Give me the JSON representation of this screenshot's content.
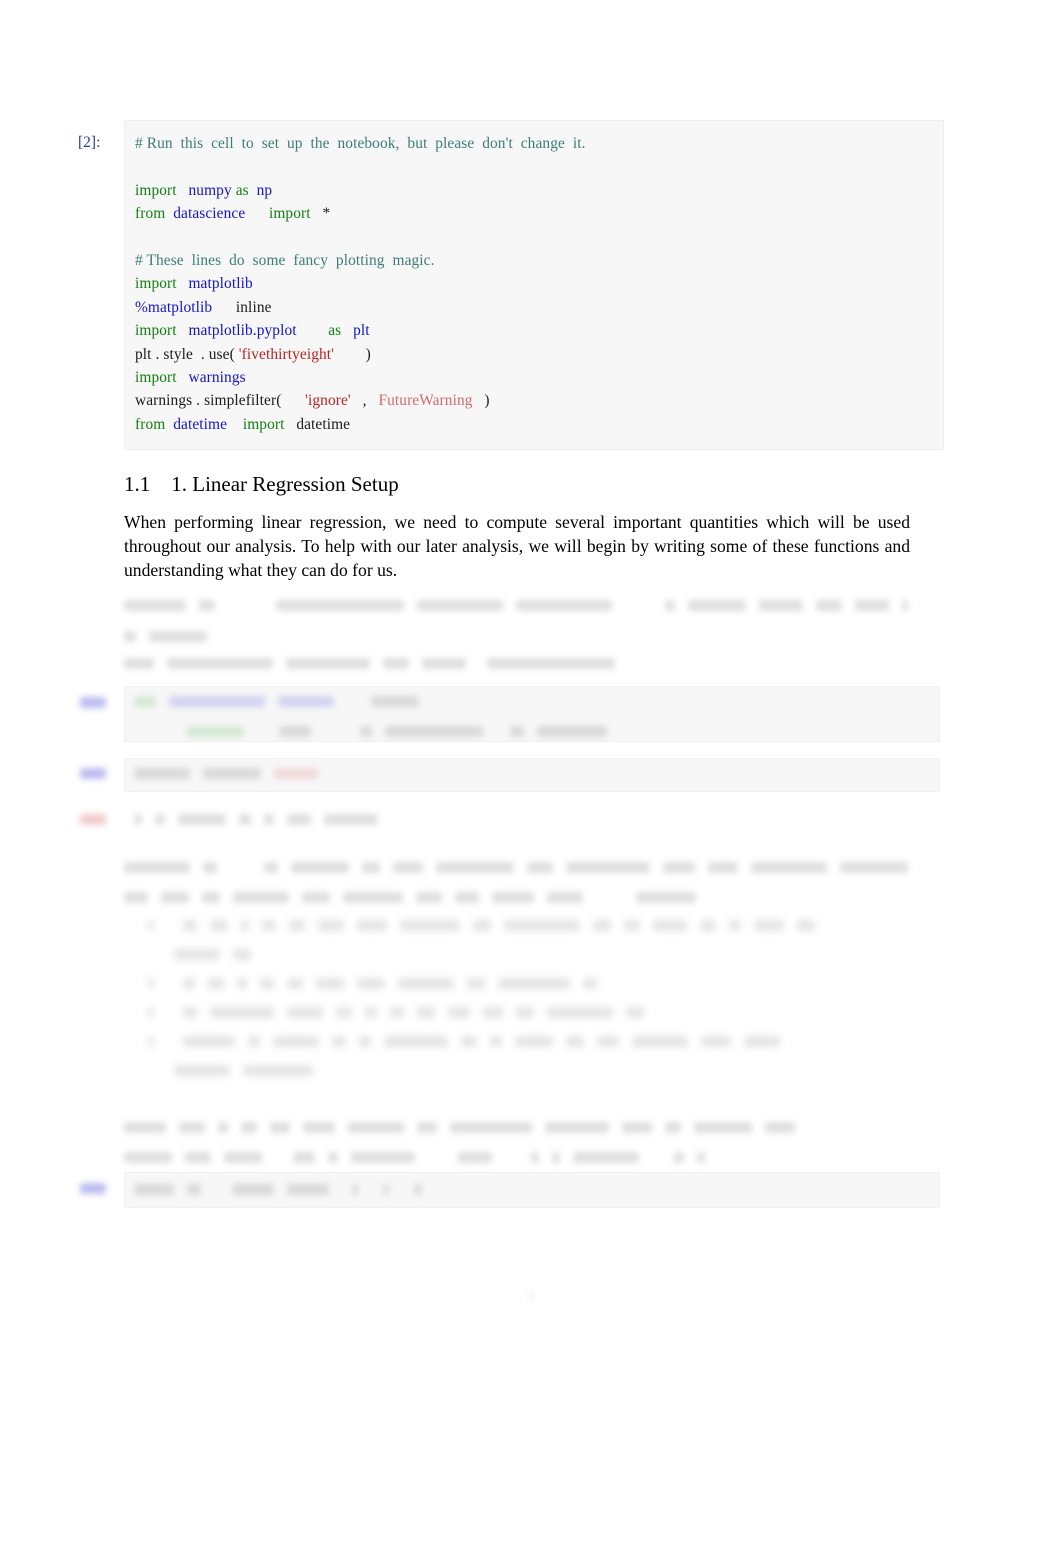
{
  "document": {
    "kind": "jupyter-notebook-export",
    "page_number": "1"
  },
  "code_cell": {
    "prompt": "[2]:",
    "lines": [
      {
        "type": "comment",
        "text": "# Run  this  cell  to  set  up  the  notebook,  but  please  don't  change  it."
      },
      {
        "type": "blank",
        "text": ""
      },
      {
        "type": "code",
        "text": "import   numpy as  np"
      },
      {
        "type": "code",
        "text": "from  datascience      import   *"
      },
      {
        "type": "blank",
        "text": ""
      },
      {
        "type": "comment",
        "text": "# These  lines  do  some  fancy  plotting  magic."
      },
      {
        "type": "code",
        "text": "import   matplotlib"
      },
      {
        "type": "code",
        "text": "%matplotlib      inline"
      },
      {
        "type": "code",
        "text": "import   matplotlib.pyplot        as   plt"
      },
      {
        "type": "code",
        "text": "plt . style  . use( 'fivethirtyeight'        )"
      },
      {
        "type": "code",
        "text": "import   warnings"
      },
      {
        "type": "code",
        "text": "warnings . simplefilter(      'ignore'   ,   FutureWarning   )"
      },
      {
        "type": "code",
        "text": "from  datetime    import   datetime"
      }
    ],
    "tokens": {
      "comment_1": "# Run  this  cell  to  set  up  the  notebook,  but  please  don't  change  it.",
      "comment_2": "# These  lines  do  some  fancy  plotting  magic.",
      "kw_import": "import",
      "kw_from": "from",
      "kw_as": "as",
      "mod_numpy": "numpy",
      "alias_np": "np",
      "mod_datascience": "datascience",
      "star": "*",
      "mod_matplotlib": "matplotlib",
      "magic_matplotlib": "%matplotlib",
      "magic_inline": "inline",
      "mod_pyplot": "matplotlib.pyplot",
      "alias_plt": "plt",
      "plt_style_use": "plt . style  . use(",
      "str_fivethirtyeight": "'fivethirtyeight'",
      "close_paren": ")",
      "mod_warnings": "warnings",
      "warnings_simplefilter": "warnings . simplefilter(",
      "str_ignore": "'ignore'",
      "comma": ",",
      "exc_futurewarning": "FutureWarning",
      "mod_datetime": "datetime",
      "name_datetime": "datetime"
    }
  },
  "section": {
    "number": "1.1",
    "title": "1. Linear Regression Setup",
    "paragraph": "When performing linear regression, we need to compute several important quantities which will be used throughout our analysis. To help with our later analysis, we will begin by writing some of these functions and understanding what they can do for us."
  },
  "redacted": {
    "note": "Remaining content on this page is blurred and unreadable in the screenshot.",
    "blocks": [
      {
        "id": "question-block-1",
        "kind": "prose"
      },
      {
        "id": "hint-line-1",
        "kind": "prose"
      },
      {
        "id": "code-cell-2",
        "kind": "code"
      },
      {
        "id": "code-cell-3",
        "kind": "code"
      },
      {
        "id": "output-cell-1",
        "kind": "output"
      },
      {
        "id": "question-block-2",
        "kind": "prose"
      },
      {
        "id": "bullet-list-1",
        "kind": "list"
      },
      {
        "id": "closing-prose-1",
        "kind": "prose"
      },
      {
        "id": "code-cell-4",
        "kind": "code"
      }
    ]
  },
  "colors": {
    "keyword": "#128012",
    "name": "#1414c8",
    "comment": "#3c7d76",
    "string": "#bb2222",
    "exception": "#d06c6c",
    "prompt_in": "#2b3a8f",
    "prompt_out": "#c45b5b",
    "cell_background": "#f7f7f7",
    "page_background": "#ffffff"
  }
}
